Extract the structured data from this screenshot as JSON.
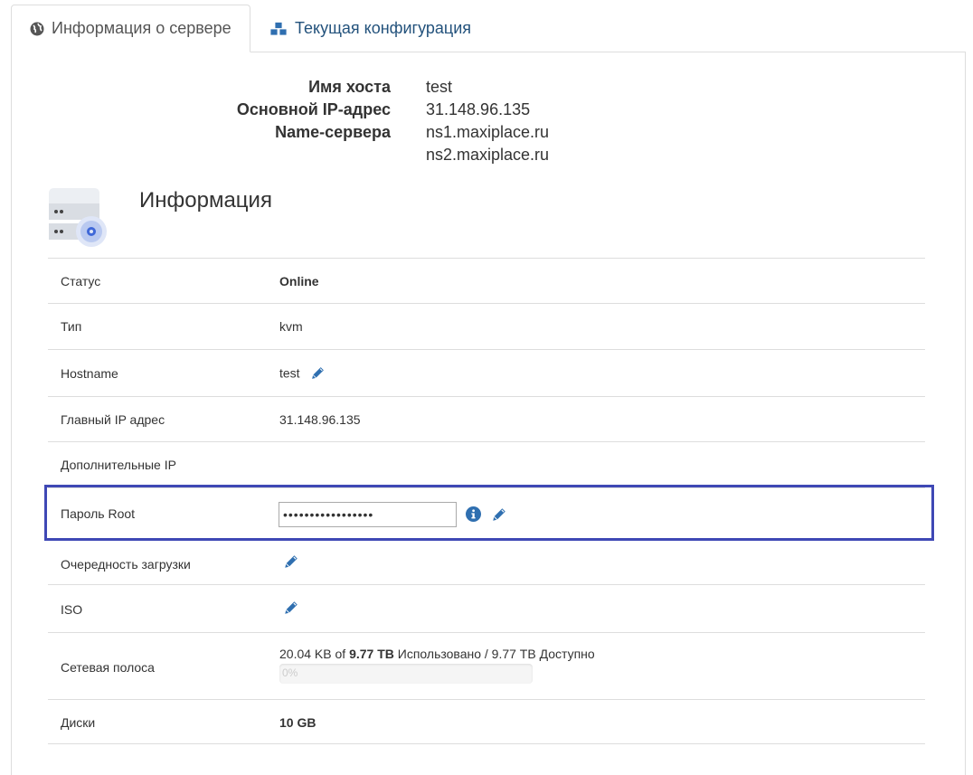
{
  "tabs": [
    {
      "label": "Информация о сервере",
      "icon": "globe-icon",
      "active": true
    },
    {
      "label": "Текущая конфигурация",
      "icon": "cubes-icon",
      "active": false
    }
  ],
  "summary": {
    "hostname_label": "Имя хоста",
    "hostname_value": "test",
    "ip_label": "Основной IP-адрес",
    "ip_value": "31.148.96.135",
    "ns_label": "Name-сервера",
    "ns1": "ns1.maxiplace.ru",
    "ns2": "ns2.maxiplace.ru"
  },
  "info": {
    "title": "Информация",
    "icon": "server-gear-icon"
  },
  "rows": {
    "status": {
      "label": "Статус",
      "value": "Online"
    },
    "type": {
      "label": "Тип",
      "value": "kvm"
    },
    "hostname": {
      "label": "Hostname",
      "value": "test"
    },
    "main_ip": {
      "label": "Главный IP адрес",
      "value": "31.148.96.135"
    },
    "extra_ip": {
      "label": "Дополнительные IP",
      "value": ""
    },
    "root_password": {
      "label": "Пароль Root",
      "value": "•••••••••••••••••"
    },
    "boot_order": {
      "label": "Очередность загрузки"
    },
    "iso": {
      "label": "ISO"
    },
    "bandwidth": {
      "label": "Сетевая полоса",
      "used": "20.04 KB",
      "of": " of ",
      "total": "9.77 TB",
      "rest": " Использовано / 9.77 TB Доступно",
      "percent_label": "0%",
      "percent": 0
    },
    "disks": {
      "label": "Диски",
      "value": "10 GB"
    }
  },
  "colors": {
    "online": "#2a8a2a",
    "link": "#23527c",
    "pencil": "#2f6fb0",
    "highlight": "#3f48b5"
  }
}
